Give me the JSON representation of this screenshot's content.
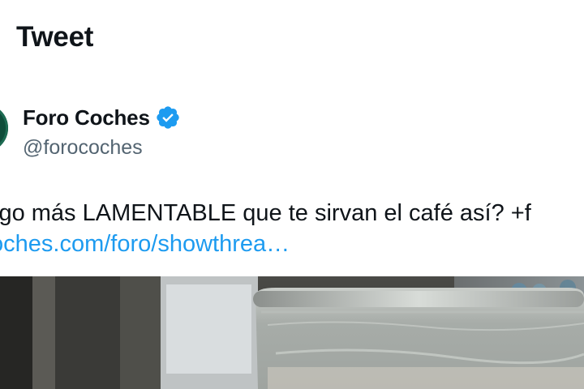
{
  "header": {
    "title": "Tweet"
  },
  "author": {
    "display_name": "Foro Coches",
    "handle": "@forocoches",
    "verified": true,
    "verified_icon": "verified-badge-icon",
    "avatar_icon": "avatar"
  },
  "tweet": {
    "text": "lgo más LAMENTABLE que te sirvan el café así? +f",
    "link": "oches.com/foro/showthrea…"
  },
  "media": {
    "type": "photo"
  },
  "colors": {
    "text": "#0f1419",
    "secondary": "#536471",
    "link": "#1d9bf0",
    "verified": "#1d9bf0"
  }
}
